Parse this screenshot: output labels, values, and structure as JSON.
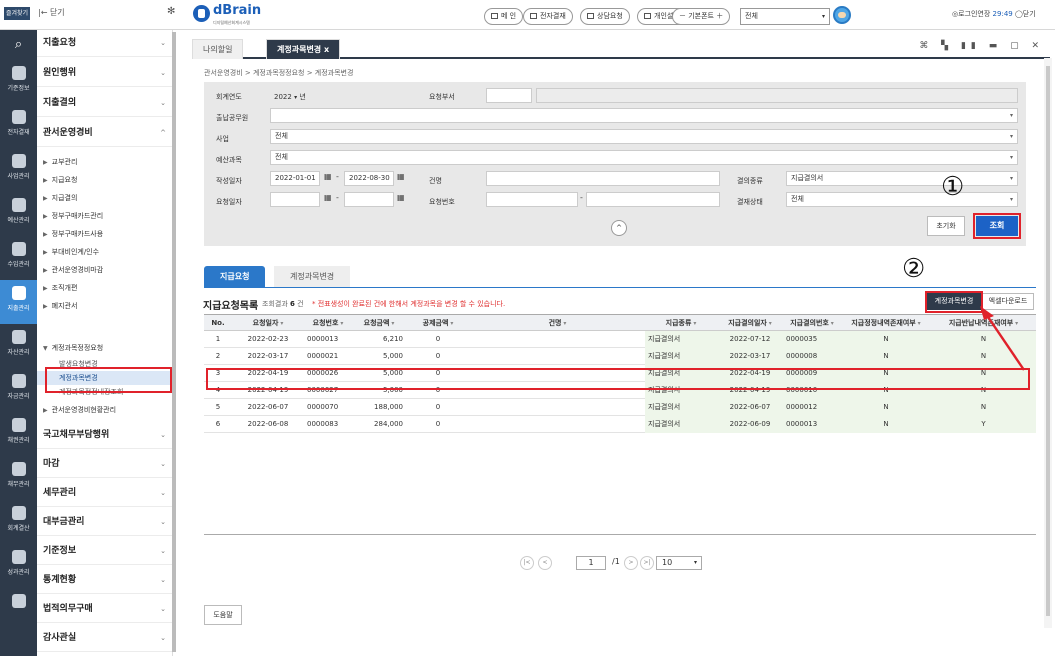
{
  "header": {
    "fav_label": "즐겨찾기",
    "collapse_label": "|← 닫기",
    "logo_name": "dBrain",
    "logo_sub": "디지털예산회계시스템",
    "buttons": [
      "메 인",
      "전자결재",
      "상담요청",
      "개인설정"
    ],
    "font_label": "－ 기본폰트 ＋",
    "select_value": "전체",
    "logout": "◎로그인연장",
    "timer": "29:49",
    "logout2": "◯닫기"
  },
  "rail": [
    {
      "label": "기준정보",
      "icon": "home-icon"
    },
    {
      "label": "전자결재",
      "icon": "pen-icon"
    },
    {
      "label": "사업관리",
      "icon": "hierarchy-icon"
    },
    {
      "label": "예산관리",
      "icon": "coins-icon"
    },
    {
      "label": "수입관리",
      "icon": "income-icon"
    },
    {
      "label": "지출관리",
      "icon": "expense-icon",
      "active": true
    },
    {
      "label": "자산관리",
      "icon": "building-icon"
    },
    {
      "label": "자금관리",
      "icon": "money-icon"
    },
    {
      "label": "채권관리",
      "icon": "bond-icon"
    },
    {
      "label": "채무관리",
      "icon": "debt-icon"
    },
    {
      "label": "회계결산",
      "icon": "ledger-icon"
    },
    {
      "label": "성과관리",
      "icon": "chart-icon"
    },
    {
      "label": "",
      "icon": "doc-icon"
    }
  ],
  "sidebar": {
    "top_menus": [
      "지출요청",
      "원인행위",
      "지출결의",
      "관서운영경비"
    ],
    "sub_items": [
      "교부관리",
      "지급요청",
      "지급결의",
      "정부구매카드관리",
      "정부구매카드사용",
      "부대비인계/인수",
      "관서운영경비마감",
      "조직개편",
      "폐지관서"
    ],
    "group_label": "계정과목정정요청",
    "group_children": [
      "발생요청변경",
      "계정과목변경",
      "계정과목정정내장조회"
    ],
    "sub_after": "관서운영경비현황관리",
    "bottom_menus": [
      "국고채무부담행위",
      "마감",
      "세무관리",
      "대부금관리",
      "기준정보",
      "통계현황",
      "법적의무구매",
      "감사관실"
    ]
  },
  "tabs": {
    "home": "나의할일",
    "active": "계정과목변경 x",
    "icons": "⌘ ▚ ▮▮ ▬ ▢ ✕"
  },
  "breadcrumb": "관서운영경비 > 계정과목정정요청 > 계정과목변경",
  "form": {
    "year_label": "회계연도",
    "year_value": "2022",
    "year_unit": "년",
    "dept_label": "요청부서",
    "officer_label": "출납공무원",
    "project_label": "사업",
    "project_value": "전체",
    "budget_label": "예산과목",
    "budget_value": "전체",
    "date_label": "작성일자",
    "date_from": "2022-01-01",
    "date_to": "2022-08-30",
    "name_label": "건명",
    "kind_label": "결의종류",
    "kind_value": "지급결의서",
    "reqdate_label": "요청일자",
    "reqno_label": "요청번호",
    "status_label": "결재상태",
    "status_value": "전체",
    "reset": "초기화",
    "search": "조회",
    "toggle": "^"
  },
  "list": {
    "tab_on": "지급요청",
    "tab_off": "계정과목변경",
    "title": "지급요청목록",
    "count_prefix": "조회결과",
    "count": "6",
    "count_suffix": "건",
    "note": "* 전표생성이 완료된 건에 한해서 계정과목을 변경 할 수 있습니다.",
    "btn_change": "계정과목변경",
    "btn_excel": "엑셀다운로드"
  },
  "table": {
    "headers": [
      "No.",
      "요청일자",
      "요청번호",
      "요청금액",
      "공제금액",
      "건명",
      "지급종류",
      "지급결의일자",
      "지급결의번호",
      "지급정정내역존재여부",
      "지급반납내역존재여부"
    ],
    "rows": [
      [
        "1",
        "2022-02-23",
        "0000013",
        "6,210",
        "0",
        "",
        "지급결의서",
        "2022-07-12",
        "0000035",
        "N",
        "N"
      ],
      [
        "2",
        "2022-03-17",
        "0000021",
        "5,000",
        "0",
        "",
        "지급결의서",
        "2022-03-17",
        "0000008",
        "N",
        "N"
      ],
      [
        "3",
        "2022-04-19",
        "0000026",
        "5,000",
        "0",
        "",
        "지급결의서",
        "2022-04-19",
        "0000009",
        "N",
        "N"
      ],
      [
        "4",
        "2022-04-19",
        "0000027",
        "5,000",
        "0",
        "",
        "지급결의서",
        "2022-04-19",
        "0000010",
        "N",
        "N"
      ],
      [
        "5",
        "2022-06-07",
        "0000070",
        "188,000",
        "0",
        "",
        "지급결의서",
        "2022-06-07",
        "0000012",
        "N",
        "N"
      ],
      [
        "6",
        "2022-06-08",
        "0000083",
        "284,000",
        "0",
        "",
        "지급결의서",
        "2022-06-09",
        "0000013",
        "N",
        "Y"
      ]
    ]
  },
  "pager": {
    "page": "1",
    "total": "/1",
    "size": "10"
  },
  "help": "도움말",
  "annotations": {
    "one": "①",
    "two": "②",
    "highlight_color": "#e0222b"
  }
}
